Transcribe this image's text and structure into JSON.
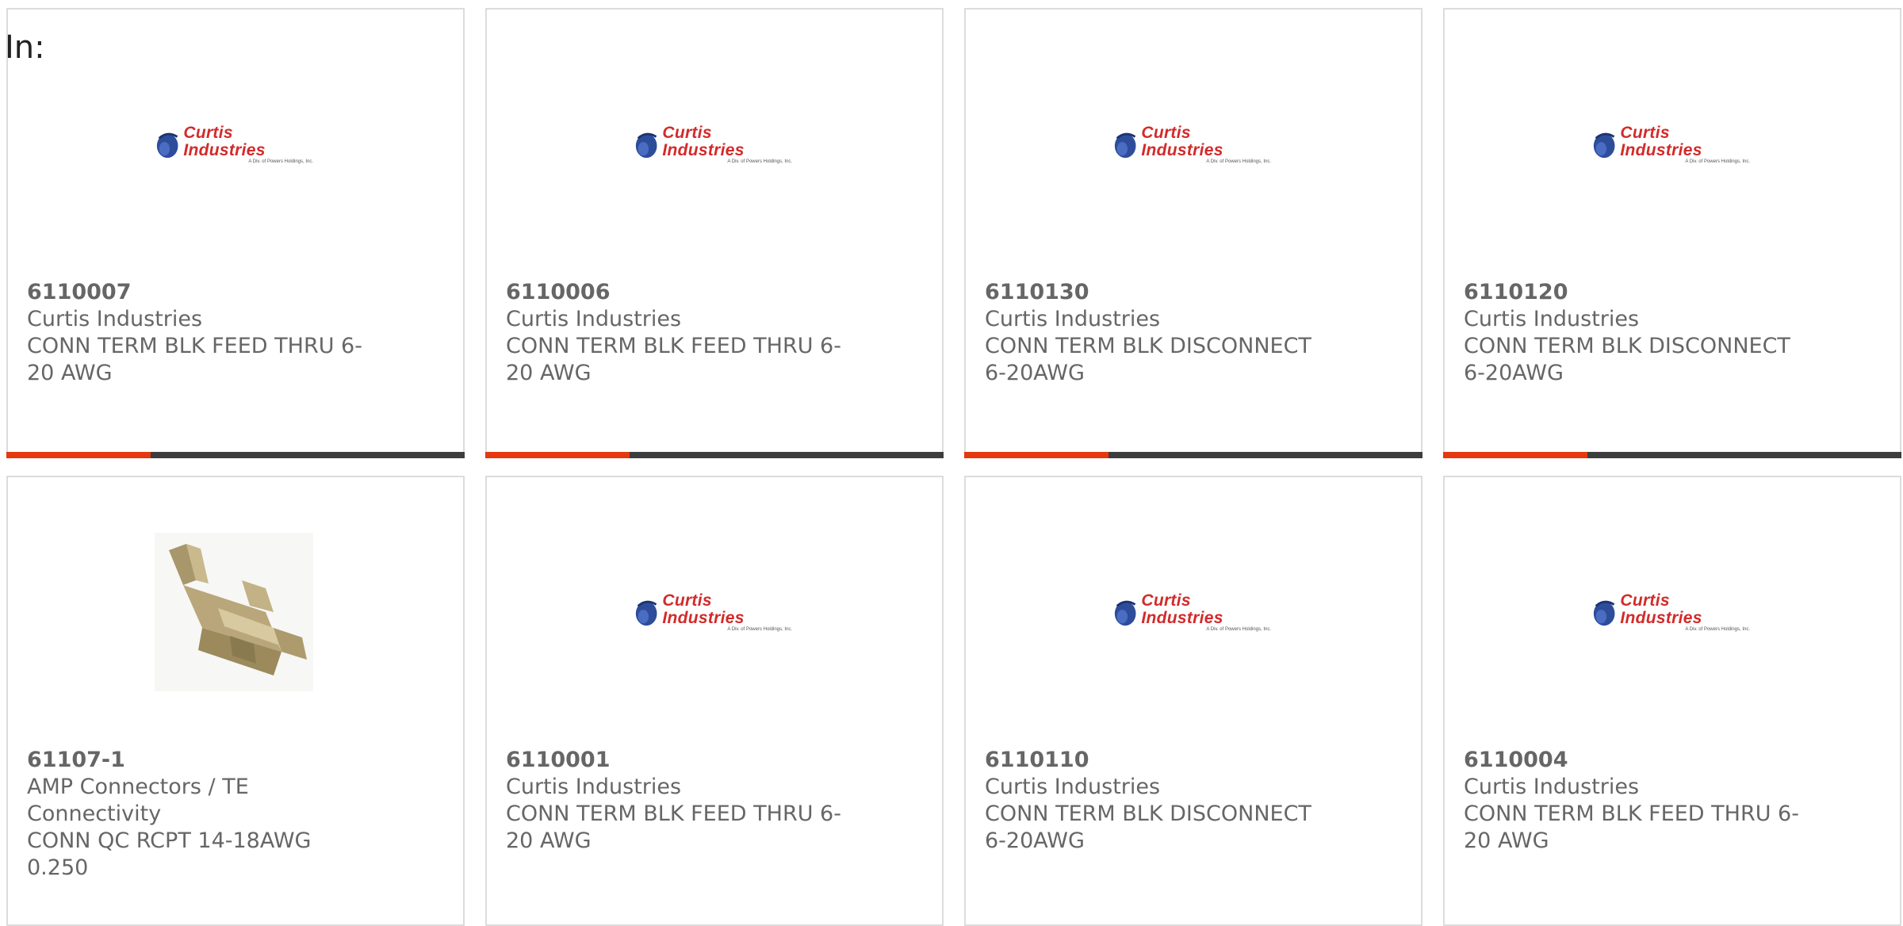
{
  "header": {
    "in_label": "In:"
  },
  "logo": {
    "brand": "Curtis Industries",
    "tagline": "A Div. of Powers Holdings, Inc."
  },
  "colors": {
    "accent": "#e6380f",
    "bar": "#3d3d3d",
    "border": "#dcdcdc",
    "text": "#666666",
    "brand_red": "#d32a2a",
    "brand_blue": "#2d4d9b"
  },
  "products": [
    {
      "part_number": "6110007",
      "manufacturer": "Curtis Industries",
      "description": "CONN TERM BLK FEED THRU 6-20 AWG",
      "image": "curtis-logo"
    },
    {
      "part_number": "6110006",
      "manufacturer": "Curtis Industries",
      "description": "CONN TERM BLK FEED THRU 6-20 AWG",
      "image": "curtis-logo"
    },
    {
      "part_number": "6110130",
      "manufacturer": "Curtis Industries",
      "description": "CONN TERM BLK DISCONNECT 6-20AWG",
      "image": "curtis-logo"
    },
    {
      "part_number": "6110120",
      "manufacturer": "Curtis Industries",
      "description": "CONN TERM BLK DISCONNECT 6-20AWG",
      "image": "curtis-logo"
    },
    {
      "part_number": "61107-1",
      "manufacturer": "AMP Connectors / TE Connectivity",
      "description": "CONN QC RCPT 14-18AWG 0.250",
      "image": "terminal-photo"
    },
    {
      "part_number": "6110001",
      "manufacturer": "Curtis Industries",
      "description": "CONN TERM BLK FEED THRU 6-20 AWG",
      "image": "curtis-logo"
    },
    {
      "part_number": "6110110",
      "manufacturer": "Curtis Industries",
      "description": "CONN TERM BLK DISCONNECT 6-20AWG",
      "image": "curtis-logo"
    },
    {
      "part_number": "6110004",
      "manufacturer": "Curtis Industries",
      "description": "CONN TERM BLK FEED THRU 6-20 AWG",
      "image": "curtis-logo"
    }
  ]
}
